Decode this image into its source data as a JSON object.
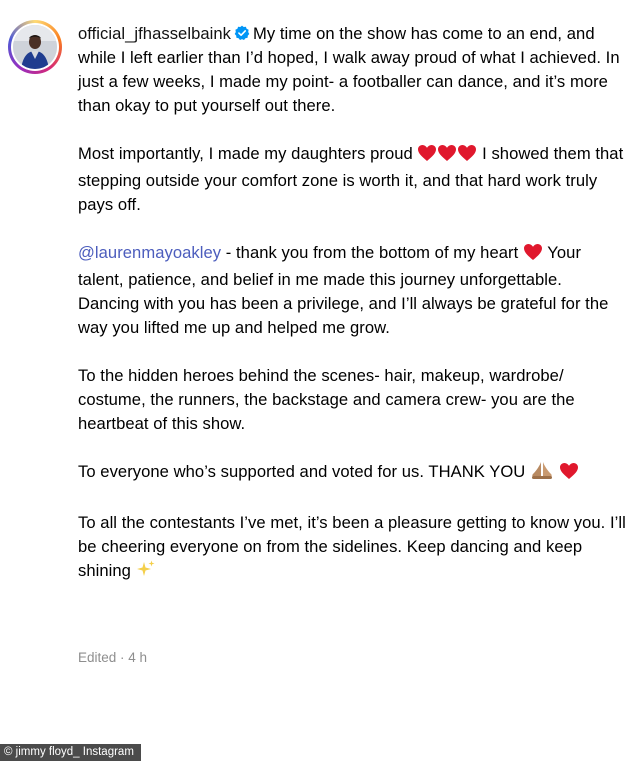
{
  "post": {
    "username": "official_jfhasselbaink",
    "verified_icon": "verified-badge-icon",
    "intro_text": "My time on the show has come to an end, and while I left earlier than I’d hoped, I walk away proud of what I achieved. In just a few weeks, I made my point- a footballer can dance, and it’s more than okay to put yourself out there.",
    "para2_before": "Most importantly, I made my daughters proud",
    "para2_after": "I showed them that stepping outside your comfort zone is worth it, and that hard work truly pays off.",
    "mention": "@laurenmayoakley",
    "para3_after_mention": "- thank you from the bottom of my heart",
    "para3_rest": "Your talent, patience, and belief in me made this journey unforgettable. Dancing with you has been a privilege, and I’ll always be grateful for the way you lifted me up and helped me grow.",
    "para4": "To the hidden heroes behind the scenes- hair, makeup, wardrobe/ costume, the runners, the backstage and camera crew- you are the heartbeat of this show.",
    "para5": "To everyone who’s supported and voted for us. THANK YOU",
    "para6": "To all the contestants I’ve met, it’s been a pleasure getting to know you. I’ll be cheering everyone on from the sidelines. Keep dancing and keep shining",
    "edited_label": "Edited · 4 h"
  },
  "emoji_icons": [
    "red-heart-icon",
    "folded-hands-icon",
    "sparkles-icon"
  ],
  "photo_credit": "© jimmy floyd_ Instagram",
  "colors": {
    "mention": "#4c5dbd",
    "meta": "#8e8e8e",
    "heart": "#e0182d",
    "verified": "#0095f6",
    "credit_bg": "#4b4b4b"
  }
}
